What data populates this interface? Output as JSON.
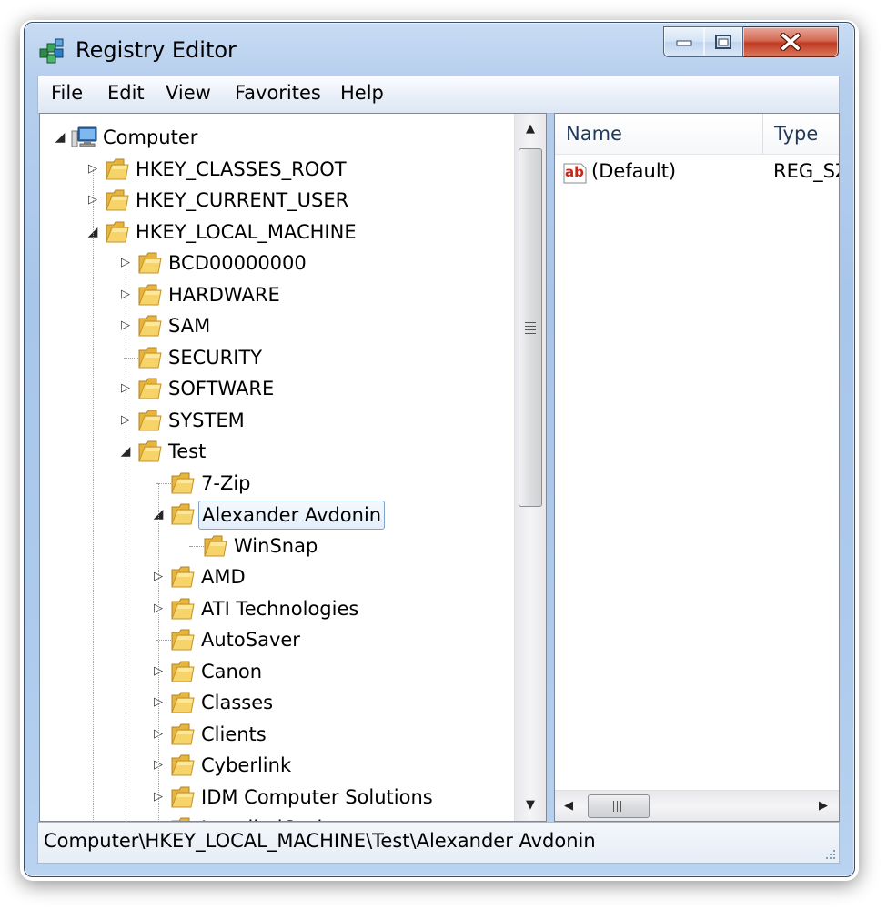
{
  "window": {
    "title": "Registry Editor"
  },
  "menu": [
    "File",
    "Edit",
    "View",
    "Favorites",
    "Help"
  ],
  "tree": {
    "nodes": [
      {
        "label": "Computer",
        "level": 0,
        "expander": "open",
        "icon": "computer-icon"
      },
      {
        "label": "HKEY_CLASSES_ROOT",
        "level": 1,
        "expander": "closed",
        "icon": "folder-icon"
      },
      {
        "label": "HKEY_CURRENT_USER",
        "level": 1,
        "expander": "closed",
        "icon": "folder-icon"
      },
      {
        "label": "HKEY_LOCAL_MACHINE",
        "level": 1,
        "expander": "open",
        "icon": "folder-icon"
      },
      {
        "label": "BCD00000000",
        "level": 2,
        "expander": "closed",
        "icon": "folder-icon"
      },
      {
        "label": "HARDWARE",
        "level": 2,
        "expander": "closed",
        "icon": "folder-icon"
      },
      {
        "label": "SAM",
        "level": 2,
        "expander": "closed",
        "icon": "folder-icon"
      },
      {
        "label": "SECURITY",
        "level": 2,
        "expander": "none",
        "icon": "folder-icon"
      },
      {
        "label": "SOFTWARE",
        "level": 2,
        "expander": "closed",
        "icon": "folder-icon"
      },
      {
        "label": "SYSTEM",
        "level": 2,
        "expander": "closed",
        "icon": "folder-icon"
      },
      {
        "label": "Test",
        "level": 2,
        "expander": "open",
        "icon": "folder-icon"
      },
      {
        "label": "7-Zip",
        "level": 3,
        "expander": "none",
        "icon": "folder-icon"
      },
      {
        "label": "Alexander Avdonin",
        "level": 3,
        "expander": "open",
        "icon": "folder-icon",
        "selected": true
      },
      {
        "label": "WinSnap",
        "level": 4,
        "expander": "none",
        "icon": "folder-icon"
      },
      {
        "label": "AMD",
        "level": 3,
        "expander": "closed",
        "icon": "folder-icon"
      },
      {
        "label": "ATI Technologies",
        "level": 3,
        "expander": "closed",
        "icon": "folder-icon"
      },
      {
        "label": "AutoSaver",
        "level": 3,
        "expander": "none",
        "icon": "folder-icon"
      },
      {
        "label": "Canon",
        "level": 3,
        "expander": "closed",
        "icon": "folder-icon"
      },
      {
        "label": "Classes",
        "level": 3,
        "expander": "closed",
        "icon": "folder-icon"
      },
      {
        "label": "Clients",
        "level": 3,
        "expander": "closed",
        "icon": "folder-icon"
      },
      {
        "label": "Cyberlink",
        "level": 3,
        "expander": "closed",
        "icon": "folder-icon"
      },
      {
        "label": "IDM Computer Solutions",
        "level": 3,
        "expander": "closed",
        "icon": "folder-icon"
      },
      {
        "label": "InstalledOptions",
        "level": 3,
        "expander": "none",
        "icon": "folder-icon"
      }
    ]
  },
  "list": {
    "columns": [
      "Name",
      "Type"
    ],
    "rows": [
      {
        "name": "(Default)",
        "type": "REG_SZ",
        "icon": "string-value-icon"
      }
    ]
  },
  "status": {
    "path": "Computer\\HKEY_LOCAL_MACHINE\\Test\\Alexander Avdonin"
  },
  "colors": {
    "selection_border": "#7da2ce",
    "folder": "#f0c24b",
    "close_button": "#c8472d"
  }
}
